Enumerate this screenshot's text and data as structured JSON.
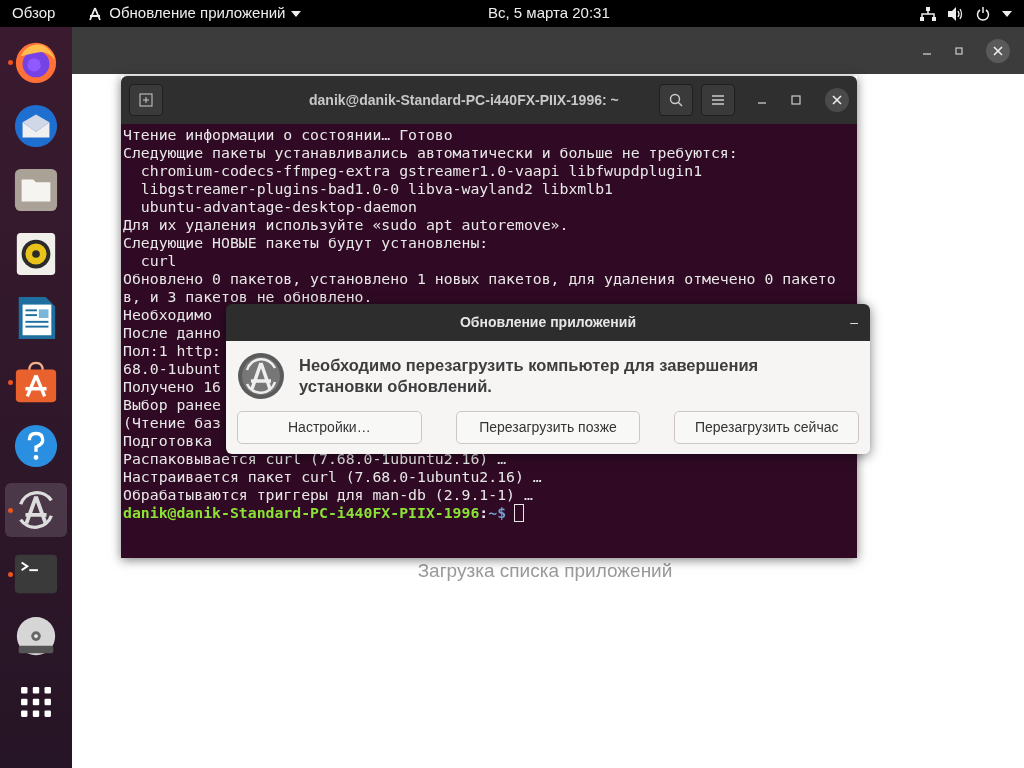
{
  "top_bar": {
    "activities": "Обзор",
    "app_menu": "Обновление приложений",
    "clock": "Вс, 5 марта  20:31"
  },
  "dock": [
    {
      "kind": "firefox",
      "running": true,
      "selected": false
    },
    {
      "kind": "mail",
      "running": false,
      "selected": false
    },
    {
      "kind": "files",
      "running": false,
      "selected": false
    },
    {
      "kind": "speaker",
      "running": false,
      "selected": false
    },
    {
      "kind": "writer",
      "running": false,
      "selected": false
    },
    {
      "kind": "store",
      "running": true,
      "selected": false
    },
    {
      "kind": "help",
      "running": false,
      "selected": false
    },
    {
      "kind": "updater",
      "running": true,
      "selected": true
    },
    {
      "kind": "terminal",
      "running": true,
      "selected": false
    },
    {
      "kind": "dvd",
      "running": false,
      "selected": false
    },
    {
      "kind": "grid",
      "running": false,
      "selected": false
    }
  ],
  "software_window": {
    "status": "Загрузка списка приложений"
  },
  "terminal": {
    "title": "danik@danik-Standard-PC-i440FX-PIIX-1996: ~",
    "lines": [
      {
        "kind": "text",
        "text": "Чтение информации о состоянии… Готово"
      },
      {
        "kind": "text",
        "text": "Следующие пакеты устанавливались автоматически и больше не требуются:"
      },
      {
        "kind": "text",
        "text": "  chromium-codecs-ffmpeg-extra gstreamer1.0-vaapi libfwupdplugin1"
      },
      {
        "kind": "text",
        "text": "  libgstreamer-plugins-bad1.0-0 libva-wayland2 libxmlb1"
      },
      {
        "kind": "text",
        "text": "  ubuntu-advantage-desktop-daemon"
      },
      {
        "kind": "text",
        "text": "Для их удаления используйте «sudo apt autoremove»."
      },
      {
        "kind": "text",
        "text": "Следующие НОВЫЕ пакеты будут установлены:"
      },
      {
        "kind": "text",
        "text": "  curl"
      },
      {
        "kind": "text",
        "text": "Обновлено 0 пакетов, установлено 1 новых пакетов, для удаления отмечено 0 пакето"
      },
      {
        "kind": "text",
        "text": "в, и 3 пакетов не обновлено."
      },
      {
        "kind": "text",
        "text": "Необходимо"
      },
      {
        "kind": "text",
        "text": "После данно"
      },
      {
        "kind": "text",
        "text": "Пол:1 http:"
      },
      {
        "kind": "text",
        "text": "68.0-1ubunt"
      },
      {
        "kind": "text",
        "text": "Получено 16"
      },
      {
        "kind": "text",
        "text": "Выбор ранее"
      },
      {
        "kind": "text",
        "text": "(Чтение баз"
      },
      {
        "kind": "text",
        "text": "Подготовка"
      },
      {
        "kind": "text",
        "text": "Распаковывается curl (7.68.0-1ubuntu2.16) …"
      },
      {
        "kind": "text",
        "text": "Настраивается пакет curl (7.68.0-1ubuntu2.16) …"
      },
      {
        "kind": "text",
        "text": "Обрабатываются триггеры для man-db (2.9.1-1) …"
      },
      {
        "kind": "prompt",
        "user": "danik@danik-Standard-PC-i440FX-PIIX-1996",
        "sep": ":",
        "path": "~$"
      }
    ]
  },
  "dialog": {
    "title": "Обновление приложений",
    "minimize": "–",
    "message": "Необходимо перезагрузить компьютер для завершения установки обновлений.",
    "buttons": [
      "Настройки…",
      "Перезагрузить позже",
      "Перезагрузить сейчас"
    ]
  }
}
